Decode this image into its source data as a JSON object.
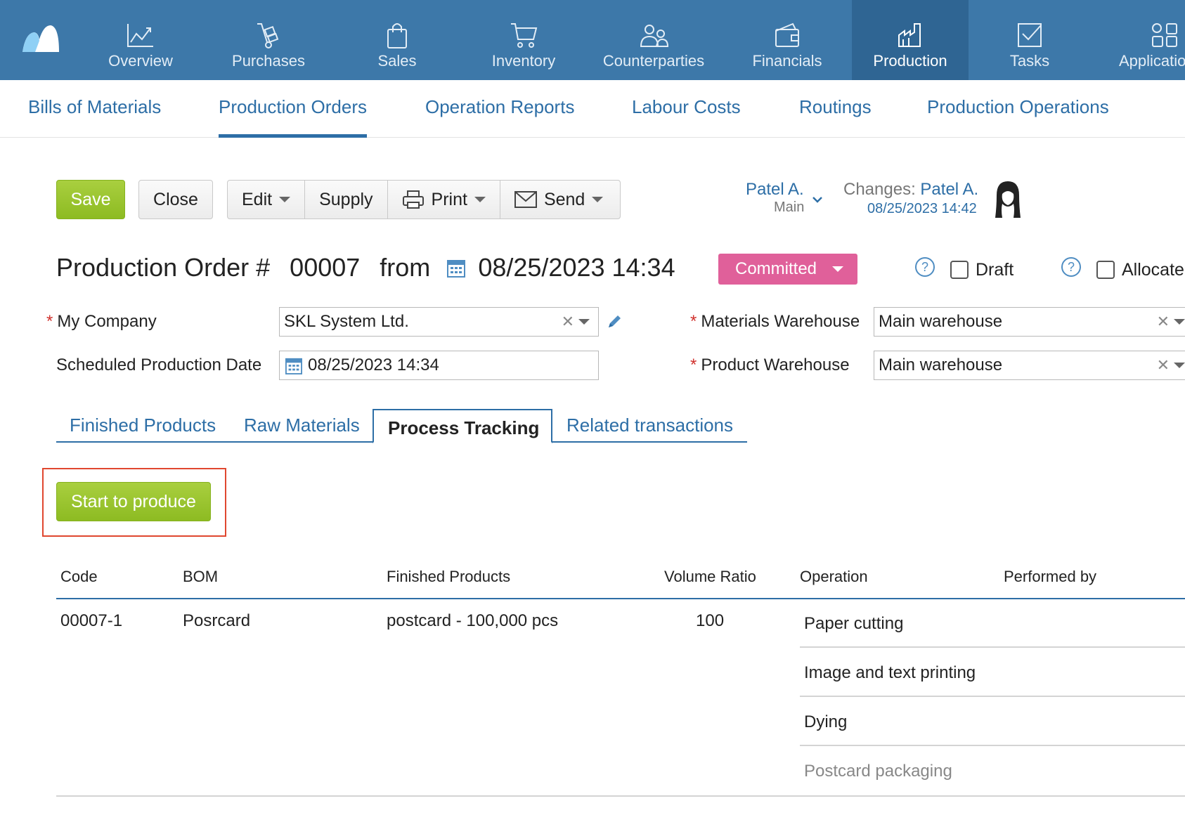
{
  "nav": {
    "items": [
      {
        "label": "Overview",
        "icon": "chart-line-icon"
      },
      {
        "label": "Purchases",
        "icon": "hand-truck-icon"
      },
      {
        "label": "Sales",
        "icon": "shopping-bag-icon"
      },
      {
        "label": "Inventory",
        "icon": "cart-icon"
      },
      {
        "label": "Counterparties",
        "icon": "people-icon"
      },
      {
        "label": "Financials",
        "icon": "wallet-icon"
      },
      {
        "label": "Production",
        "icon": "factory-icon"
      },
      {
        "label": "Tasks",
        "icon": "checkbox-icon"
      },
      {
        "label": "Applicatio",
        "icon": "apps-grid-icon"
      }
    ],
    "active": "Production"
  },
  "subnav": {
    "items": [
      "Bills of Materials",
      "Production Orders",
      "Operation Reports",
      "Labour Costs",
      "Routings",
      "Production Operations"
    ],
    "active": "Production Orders"
  },
  "toolbar": {
    "save": "Save",
    "close": "Close",
    "edit": "Edit",
    "supply": "Supply",
    "print": "Print",
    "send": "Send"
  },
  "owner": {
    "name": "Patel A.",
    "group": "Main",
    "changes_label": "Changes:",
    "changes_user": "Patel A.",
    "changes_time": "08/25/2023 14:42"
  },
  "document": {
    "title_prefix": "Production Order #",
    "number": "00007",
    "from": "from",
    "datetime": "08/25/2023 14:34",
    "status": "Committed",
    "status_color": "#e0609a",
    "draft_label": "Draft",
    "allocate_label": "Allocate"
  },
  "form": {
    "company_label": "My Company",
    "company_value": "SKL System Ltd.",
    "date_label": "Scheduled Production Date",
    "date_value": "08/25/2023 14:34",
    "materials_wh_label": "Materials Warehouse",
    "materials_wh_value": "Main warehouse",
    "product_wh_label": "Product Warehouse",
    "product_wh_value": "Main warehouse"
  },
  "tabs": {
    "items": [
      "Finished Products",
      "Raw Materials",
      "Process Tracking",
      "Related transactions"
    ],
    "active": "Process Tracking"
  },
  "start_button": "Start to produce",
  "table": {
    "headers": [
      "Code",
      "BOM",
      "Finished Products",
      "Volume Ratio",
      "Operation",
      "Performed by"
    ],
    "row": {
      "code": "00007-1",
      "bom": "Posrcard",
      "finished": "postcard - 100,000 pcs",
      "volume": "100",
      "operations": [
        "Paper cutting",
        "Image and text printing",
        "Dying",
        "Postcard packaging"
      ]
    }
  }
}
